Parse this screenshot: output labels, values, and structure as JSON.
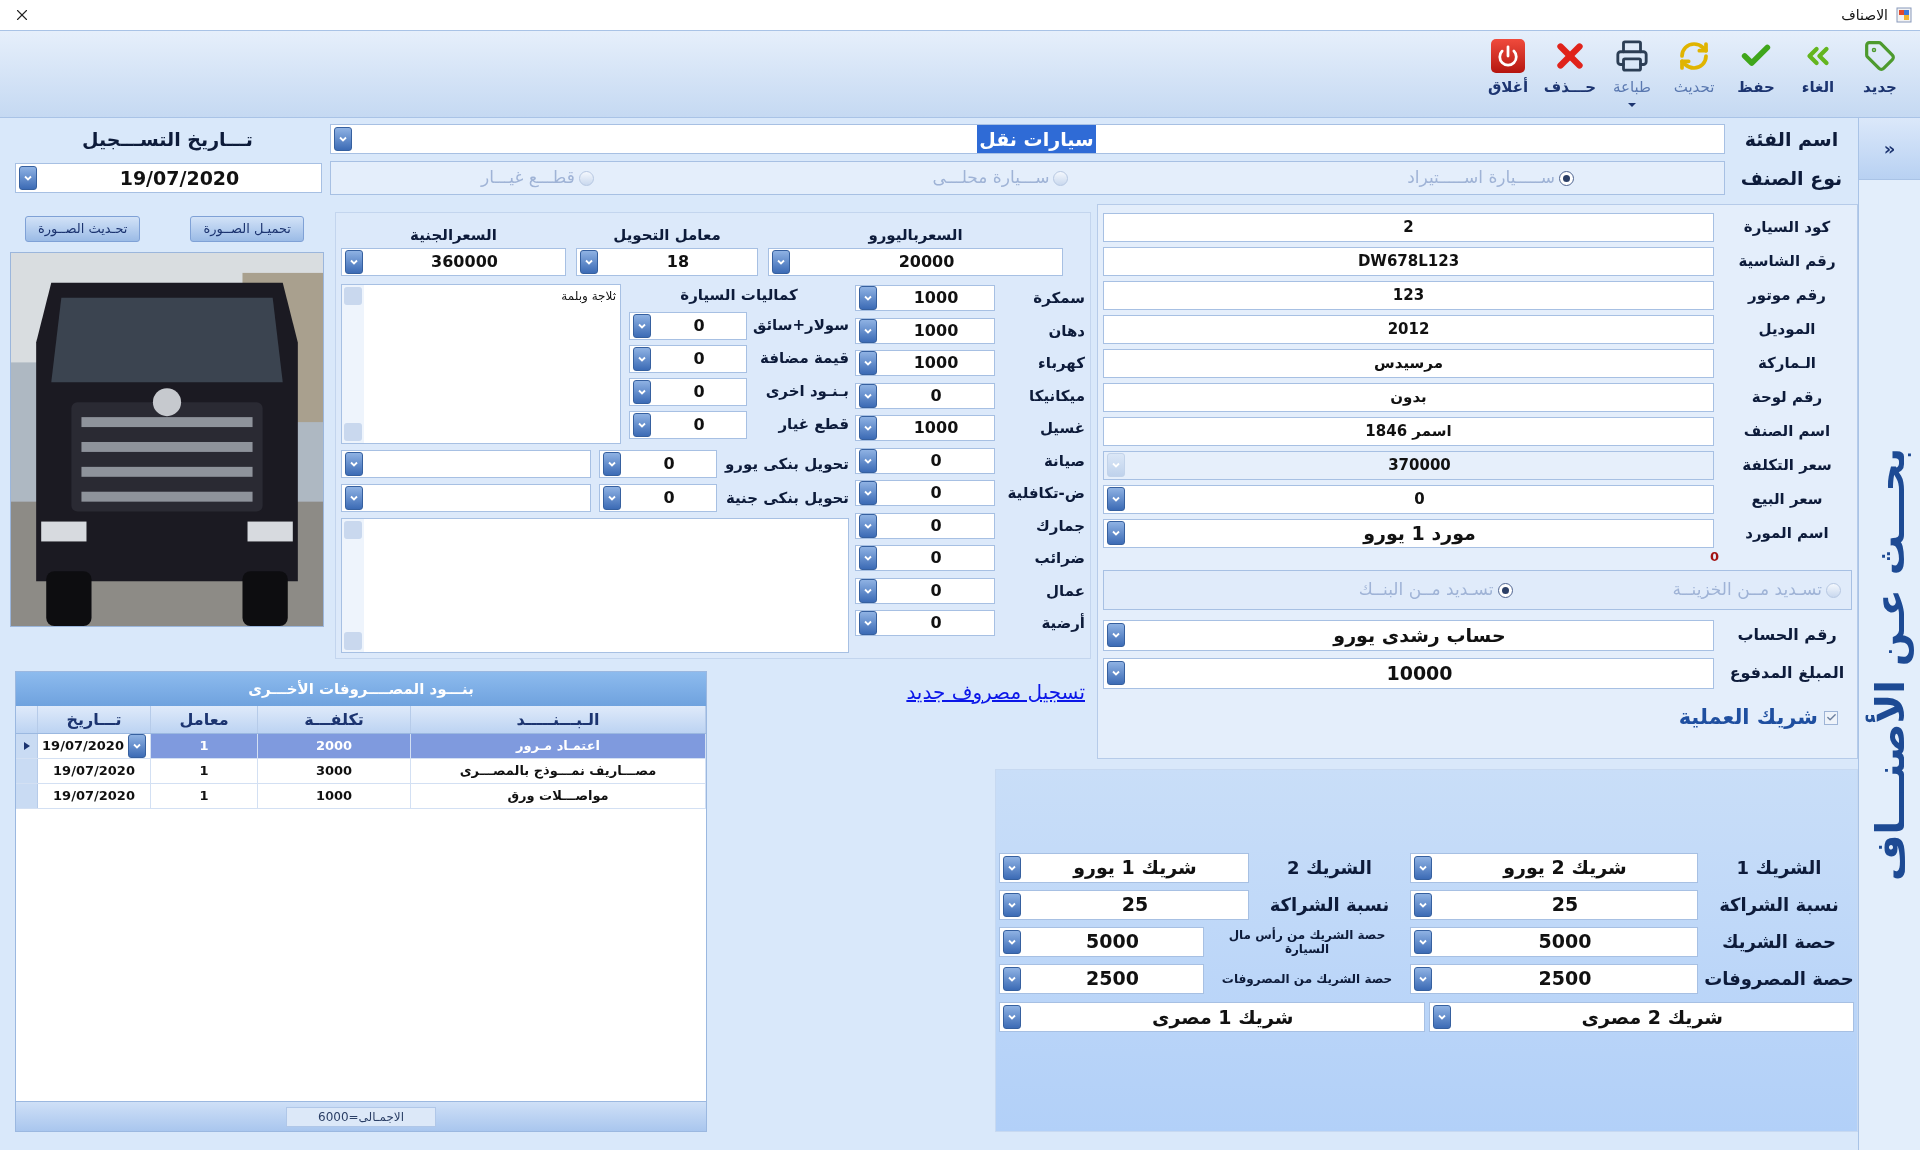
{
  "window": {
    "title": "الاصناف"
  },
  "toolbar": [
    {
      "label": "جديد",
      "kind": "new"
    },
    {
      "label": "الغاء",
      "kind": "cancel"
    },
    {
      "label": "حفظ",
      "kind": "save"
    },
    {
      "label": "تحديث",
      "kind": "refresh"
    },
    {
      "label": "طباعة",
      "kind": "print"
    },
    {
      "label": "حـــذف",
      "kind": "delete"
    },
    {
      "label": "أغلاق",
      "kind": "close"
    }
  ],
  "category": {
    "label": "اسم الفئة",
    "value": "سيارات نقل"
  },
  "registration_date": {
    "label": "تـــاريخ التســـجيل",
    "value": "19/07/2020"
  },
  "item_type": {
    "label": "نوع الصنف",
    "options": [
      {
        "label": "ســـــيارة اســـــتيراد",
        "selected": true
      },
      {
        "label": "ســـيارة محلـــى",
        "selected": false
      },
      {
        "label": "قطـــع غيـــار",
        "selected": false
      }
    ]
  },
  "photo": {
    "buttons": [
      "تحميـل الصــورة",
      "تحـديث الصــورة"
    ]
  },
  "prices": [
    {
      "label": "السعرباليورو",
      "value": "20000"
    },
    {
      "label": "معامل التحويل",
      "value": "18"
    },
    {
      "label": "السعرالجنية",
      "value": "360000"
    }
  ],
  "costs": [
    {
      "label": "سمكرة",
      "value": "1000"
    },
    {
      "label": "دهان",
      "value": "1000"
    },
    {
      "label": "كهرباء",
      "value": "1000"
    },
    {
      "label": "ميكانيكا",
      "value": "0"
    },
    {
      "label": "غسيل",
      "value": "1000"
    },
    {
      "label": "صيانة",
      "value": "0"
    },
    {
      "label": "ض-تكافلية",
      "value": "0"
    },
    {
      "label": "جمارك",
      "value": "0"
    },
    {
      "label": "ضرائب",
      "value": "0"
    },
    {
      "label": "عمال",
      "value": "0"
    },
    {
      "label": "أرضية",
      "value": "0"
    }
  ],
  "accessories": {
    "title": "كماليات السيارة",
    "notes": "ثلاجة وبلمة",
    "rows": [
      {
        "label": "سولار+سائق",
        "value": "0"
      },
      {
        "label": "قيمة مضافة",
        "value": "0"
      },
      {
        "label": "بـنـود اخرى",
        "value": "0"
      },
      {
        "label": "قطع غيار",
        "value": "0"
      }
    ]
  },
  "transfers": [
    {
      "label": "تحويل بنكى يورو",
      "value": "0"
    },
    {
      "label": "تحويل بنكى جنية",
      "value": "0"
    }
  ],
  "details": [
    {
      "label": "كود السيارة",
      "value": "2",
      "kind": "text"
    },
    {
      "label": "رقم الشاسية",
      "value": "DW678L123",
      "kind": "text"
    },
    {
      "label": "رقم موتور",
      "value": "123",
      "kind": "text"
    },
    {
      "label": "الموديل",
      "value": "2012",
      "kind": "text"
    },
    {
      "label": "الـماركة",
      "value": "مرسيدس",
      "kind": "text"
    },
    {
      "label": "رقم لوحة",
      "value": "بدون",
      "kind": "text"
    },
    {
      "label": "اسم الصنف",
      "value": "اسمر 1846",
      "kind": "text"
    },
    {
      "label": "سعر التكلفة",
      "value": "370000",
      "kind": "locked"
    },
    {
      "label": "سعر البيع",
      "value": "0",
      "kind": "combo"
    },
    {
      "label": "اسم المورد",
      "value": "مورد 1 يورو",
      "kind": "combo"
    }
  ],
  "supplier_balance": "0",
  "payment": {
    "options": [
      {
        "label": "تسـديد مــن الخزينــة",
        "selected": false
      },
      {
        "label": "تسـديد مــن البنــك",
        "selected": true
      }
    ]
  },
  "payment_fields": [
    {
      "label": "رقم الحساب",
      "value": "حساب رشدى يورو"
    },
    {
      "label": "المبلغ المدفوع",
      "value": "10000"
    }
  ],
  "partner_checkbox": {
    "label": "شريك العملية",
    "checked": true
  },
  "new_expense_link": "تسجيل مصروف جديد",
  "expenses": {
    "title": "بنـــود المصــــروفات الأخـــرى",
    "columns": [
      "الـبـــنـــــد",
      "تكلفـــة",
      "معامل",
      "تـــاريخ"
    ],
    "rows": [
      {
        "cells": [
          "اعتمـاد مـرور",
          "2000",
          "1",
          "19/07/2020"
        ],
        "selected": true
      },
      {
        "cells": [
          "مصـــاريف نمـــوذج بالمصـــرى",
          "3000",
          "1",
          "19/07/2020"
        ],
        "selected": false
      },
      {
        "cells": [
          "مواصـــلات ورق",
          "1000",
          "1",
          "19/07/2020"
        ],
        "selected": false
      }
    ],
    "total": "الاجمـالى=6000"
  },
  "partners": [
    {
      "rows": [
        {
          "label": "الشريك 1",
          "value": "شريك 2 يورو"
        },
        {
          "label": "نسبة الشراكة",
          "value": "25"
        },
        {
          "label": "حصة الشريك",
          "value": "5000"
        },
        {
          "label": "حصة المصروفات",
          "value": "2500"
        }
      ],
      "egp_account": "شريك 2 مصرى"
    },
    {
      "rows": [
        {
          "label": "الشريك 2",
          "value": "شريك 1 يورو"
        },
        {
          "label": "نسبة الشراكة",
          "value": "25"
        },
        {
          "label": "حصة الشريك من رأس مال السيارة",
          "value": "5000"
        },
        {
          "label": "حصة الشريك من المصروفات",
          "value": "2500"
        }
      ],
      "egp_account": "شريك 1 مصرى"
    }
  ],
  "sidebar": {
    "toggle": "»",
    "title": "بحـــث عـن الأصنـــاف"
  }
}
